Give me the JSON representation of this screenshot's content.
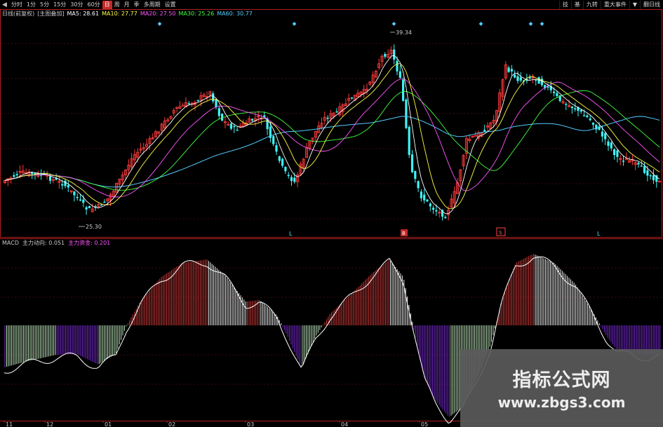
{
  "toolbar": {
    "items": [
      {
        "label": "分时"
      },
      {
        "label": "1分"
      },
      {
        "label": "5分"
      },
      {
        "label": "15分"
      },
      {
        "label": "30分"
      },
      {
        "label": "60分"
      },
      {
        "label": "日",
        "active": true
      },
      {
        "label": "周"
      },
      {
        "label": "月"
      },
      {
        "label": "季"
      },
      {
        "label": "多周期"
      },
      {
        "label": "设置"
      }
    ],
    "right_items": [
      {
        "label": "技"
      },
      {
        "label": "基"
      },
      {
        "label": "九转"
      },
      {
        "label": "重大事件"
      },
      {
        "label": "▼"
      },
      {
        "label": "翻日线"
      }
    ]
  },
  "main_legend": {
    "items": [
      {
        "text": "日线(前复权)",
        "color": "#c8c8c8"
      },
      {
        "text": "[主图叠加]",
        "color": "#c8c8c8"
      },
      {
        "text": "MA5: 28.61",
        "color": "#ffffff"
      },
      {
        "text": "MA10: 27.77",
        "color": "#ffff44"
      },
      {
        "text": "MA20: 27.50",
        "color": "#ff55ff"
      },
      {
        "text": "MA30: 25.26",
        "color": "#44ff44"
      },
      {
        "text": "MA60: 30.77",
        "color": "#55ccff"
      }
    ]
  },
  "price_marks": {
    "high": "39.34",
    "low": "25.30"
  },
  "signal_labels": {
    "l1": "L",
    "l2": "L",
    "b1": "B",
    "b2": "S"
  },
  "sub_legend": {
    "items": [
      {
        "text": "MACD",
        "color": "#c8c8c8"
      },
      {
        "text": "主力动向: 0.051",
        "color": "#c8c8c8"
      },
      {
        "text": "主力资金: 0.201",
        "color": "#ff55ff"
      }
    ]
  },
  "date_axis": {
    "labels": [
      "11",
      "12",
      "01",
      "02",
      "03",
      "04",
      "05"
    ]
  },
  "watermark": {
    "title": "指标公式网",
    "url": "www.zbgs3.com"
  },
  "colors": {
    "up": "#ff3b3b",
    "down": "#3ff4f4",
    "grid": "#7a1414",
    "axis": "#b02020",
    "hist_pos": "#d23a3a",
    "hist_neg": "#7a2bd8",
    "hist_white": "#eeeeee"
  }
}
